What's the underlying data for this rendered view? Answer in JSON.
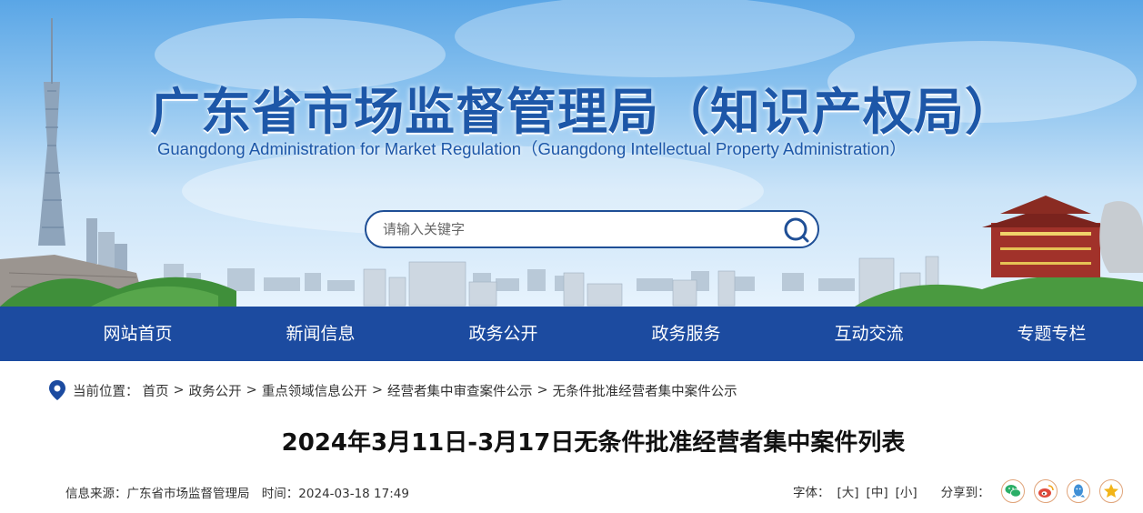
{
  "header": {
    "title": "广东省市场监督管理局（知识产权局）",
    "subtitle": "Guangdong Administration for Market Regulation（Guangdong Intellectual Property Administration）"
  },
  "search": {
    "placeholder": "请输入关键字"
  },
  "nav": {
    "items": [
      {
        "label": "网站首页"
      },
      {
        "label": "新闻信息"
      },
      {
        "label": "政务公开"
      },
      {
        "label": "政务服务"
      },
      {
        "label": "互动交流"
      },
      {
        "label": "专题专栏"
      }
    ]
  },
  "breadcrumb": {
    "label": "当前位置：",
    "items": [
      "首页",
      "政务公开",
      "重点领域信息公开",
      "经营者集中审查案件公示",
      "无条件批准经营者集中案件公示"
    ],
    "separator": ">"
  },
  "article": {
    "title": "2024年3月11日-3月17日无条件批准经营者集中案件列表",
    "source": "信息来源：广东省市场监督管理局",
    "time": "时间：2024-03-18 17:49"
  },
  "tools": {
    "font_label": "字体：",
    "font_large": "[大]",
    "font_medium": "[中]",
    "font_small": "[小]",
    "share_label": "分享到："
  },
  "colors": {
    "brand_blue": "#1c4ba0",
    "title_blue": "#1d57a8",
    "share_green": "#2aae67",
    "share_red": "#e04a3c",
    "share_blue": "#3f8fd6",
    "share_yellow": "#f2b418"
  },
  "icons": {
    "search": "search-icon",
    "location": "location-pin-icon",
    "share": [
      "wechat-icon",
      "weibo-icon",
      "qq-icon",
      "qzone-icon"
    ]
  }
}
